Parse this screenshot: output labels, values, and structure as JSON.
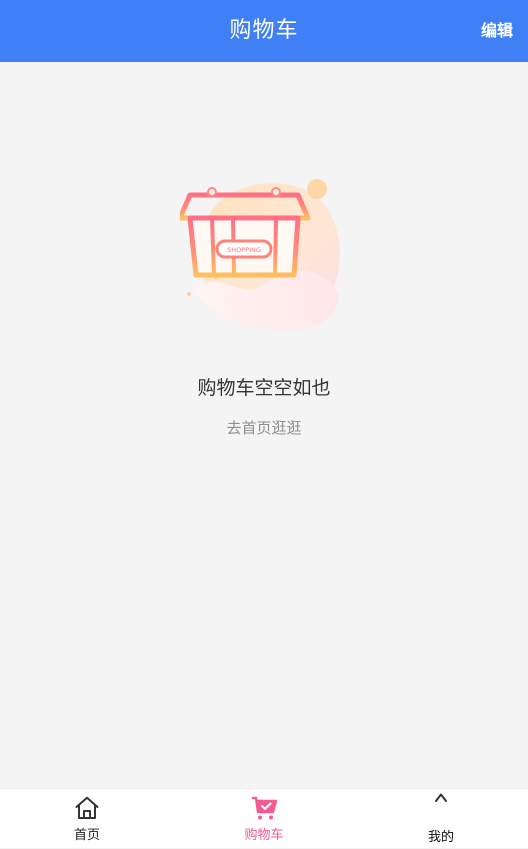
{
  "header": {
    "title": "购物车",
    "edit_label": "编辑"
  },
  "empty_state": {
    "illustration_icon": "shopping-basket-illustration",
    "basket_label": "SHOPPING",
    "title": "购物车空空如也",
    "link_text": "去首页逛逛"
  },
  "tabbar": {
    "tabs": [
      {
        "label": "首页",
        "icon": "home-icon",
        "active": false
      },
      {
        "label": "购物车",
        "icon": "cart-icon",
        "active": true
      },
      {
        "label": "我的",
        "icon": "person-icon",
        "active": false
      }
    ]
  },
  "colors": {
    "header_background": "#3f80f6",
    "page_background": "#f4f4f5",
    "active_tab": "#f35b92",
    "tabbar_background": "#ffffff"
  }
}
